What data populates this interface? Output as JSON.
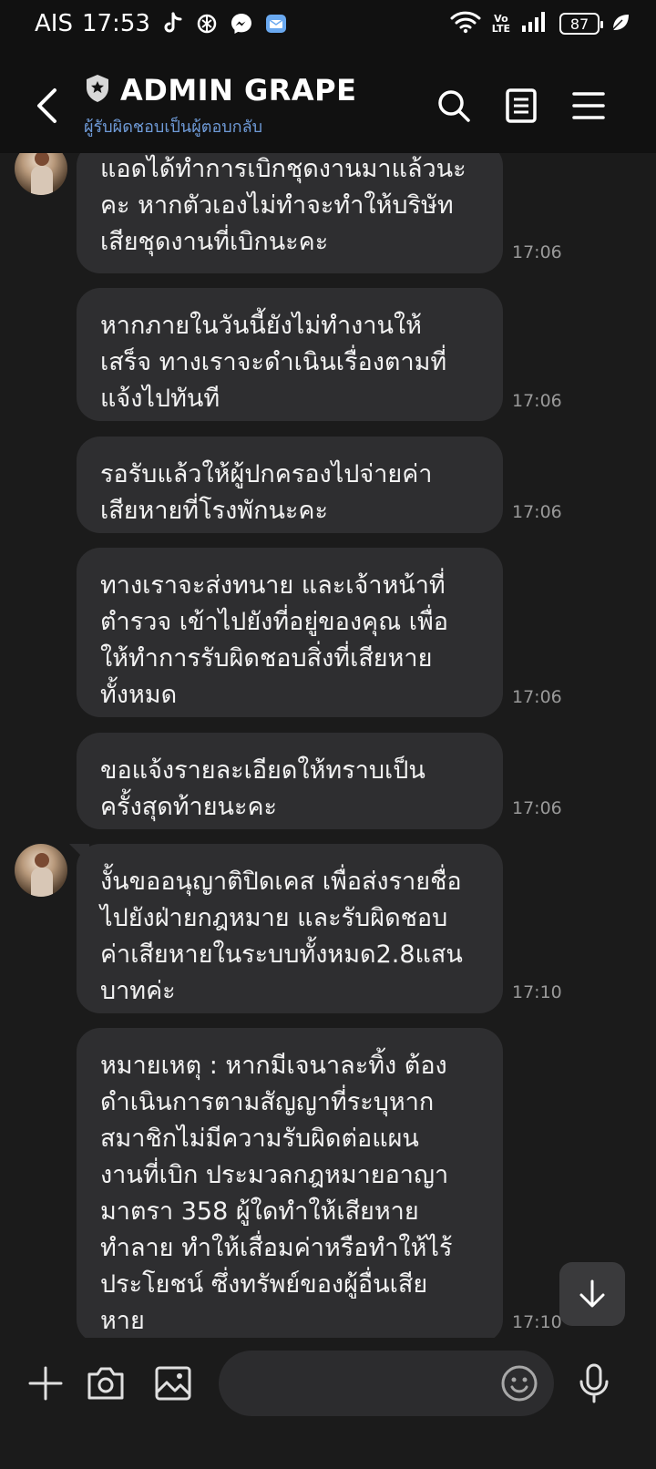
{
  "status_bar": {
    "carrier": "AIS",
    "time": "17:53",
    "network_label_top": "Vo",
    "network_label_bottom": "LTE",
    "battery": "87"
  },
  "header": {
    "title": "ADMIN GRAPE",
    "subtitle": "ผู้รับผิดชอบเป็นผู้ตอบกลับ"
  },
  "messages": [
    {
      "text": "แอดได้ทำการเบิกชุดงานมาแล้วนะ\nคะ หากตัวเองไม่ทำจะทำให้บริษัท\nเสียชุดงานที่เบิกนะคะ",
      "time": "17:06"
    },
    {
      "text": "หากภายในวันนี้ยังไม่ทำงานให้\nเสร็จ ทางเราจะดำเนินเรื่องตามที่\nแจ้งไปทันที",
      "time": "17:06"
    },
    {
      "text": "รอรับแล้วให้ผู้ปกครองไปจ่ายค่า\nเสียหายที่โรงพักนะคะ",
      "time": "17:06"
    },
    {
      "text": "ทางเราจะส่งทนาย และเจ้าหน้าที่\nตำรวจ เข้าไปยังที่อยู่ของคุณ เพื่อ\nให้ทำการรับผิดชอบสิ่งที่เสียหาย\nทั้งหมด",
      "time": "17:06"
    },
    {
      "text": "ขอแจ้งรายละเอียดให้ทราบเป็น\nครั้งสุดท้ายนะคะ",
      "time": "17:06"
    },
    {
      "text": "งั้นขออนุญาติปิดเคส เพื่อส่งรายชื่อ\nไปยังฝ่ายกฎหมาย  และรับผิดชอบ\nค่าเสียหายในระบบทั้งหมด2.8แสน\nบาทค่ะ",
      "time": "17:10"
    },
    {
      "text": "หมายเหตุ : หากมีเจนาละทิ้ง ต้อง\nดำเนินการตามสัญญาที่ระบุหาก\nสมาชิกไม่มีความรับผิดต่อแผน\nงานที่เบิก ประมวลกฎหมายอาญา\nมาตรา 358 ผู้ใดทำให้เสียหาย\nทำลาย ทำให้เสื่อมค่าหรือทำให้ไร้\nประโยชน์ ซึ่งทรัพย์ของผู้อื่นเสีย\nหาย",
      "time": "17:10"
    }
  ],
  "input": {
    "placeholder": ""
  },
  "icons": {
    "back": "chevron-left-icon",
    "shield": "shield-icon",
    "search": "search-icon",
    "notes": "notes-icon",
    "menu": "menu-icon",
    "add": "plus-icon",
    "camera": "camera-icon",
    "image": "image-icon",
    "emoji": "emoji-icon",
    "mic": "microphone-icon",
    "scroll_down": "arrow-down-icon"
  },
  "colors": {
    "background": "#1b1b1b",
    "header": "#111111",
    "bubble": "#2e2e30",
    "subtitle": "#6f9bd8",
    "timestamp": "#9a9a9a"
  }
}
